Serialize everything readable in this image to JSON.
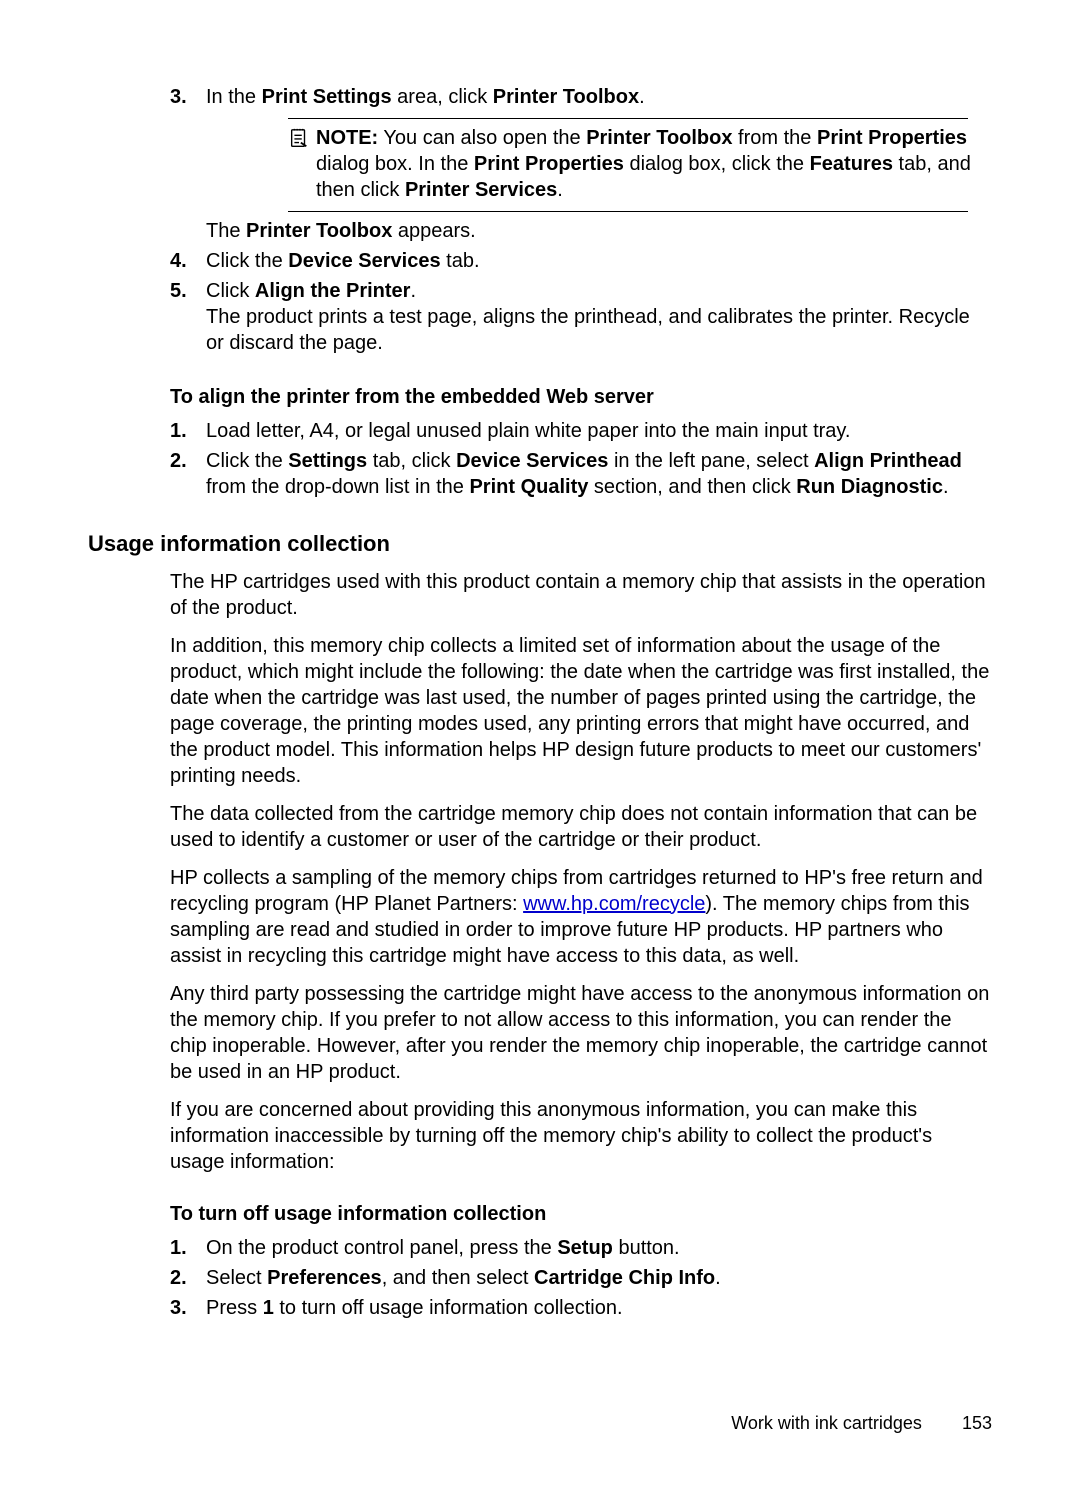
{
  "list1": {
    "items": [
      {
        "num": "3.",
        "parts": [
          {
            "t": "In the "
          },
          {
            "t": "Print Settings",
            "b": true
          },
          {
            "t": " area, click "
          },
          {
            "t": "Printer Toolbox",
            "b": true
          },
          {
            "t": "."
          }
        ],
        "note": {
          "label": "NOTE:",
          "parts": [
            {
              "t": "You can also open the "
            },
            {
              "t": "Printer Toolbox",
              "b": true
            },
            {
              "t": " from the "
            },
            {
              "t": "Print Properties",
              "b": true
            },
            {
              "t": " dialog box. In the "
            },
            {
              "t": "Print Properties",
              "b": true
            },
            {
              "t": " dialog box, click the "
            },
            {
              "t": "Features",
              "b": true
            },
            {
              "t": " tab, and then click "
            },
            {
              "t": "Printer Services",
              "b": true
            },
            {
              "t": "."
            }
          ]
        },
        "after": [
          {
            "t": "The "
          },
          {
            "t": "Printer Toolbox",
            "b": true
          },
          {
            "t": " appears."
          }
        ]
      },
      {
        "num": "4.",
        "parts": [
          {
            "t": "Click the "
          },
          {
            "t": "Device Services",
            "b": true
          },
          {
            "t": " tab."
          }
        ]
      },
      {
        "num": "5.",
        "parts": [
          {
            "t": "Click "
          },
          {
            "t": "Align the Printer",
            "b": true
          },
          {
            "t": "."
          }
        ],
        "sub": [
          {
            "t": "The product prints a test page, aligns the printhead, and calibrates the printer. Recycle or discard the page."
          }
        ]
      }
    ]
  },
  "align_ews_heading": "To align the printer from the embedded Web server",
  "list2": {
    "items": [
      {
        "num": "1.",
        "parts": [
          {
            "t": "Load letter, A4, or legal unused plain white paper into the main input tray."
          }
        ]
      },
      {
        "num": "2.",
        "parts": [
          {
            "t": "Click the "
          },
          {
            "t": "Settings",
            "b": true
          },
          {
            "t": " tab, click "
          },
          {
            "t": "Device Services",
            "b": true
          },
          {
            "t": " in the left pane, select "
          },
          {
            "t": "Align Printhead",
            "b": true
          },
          {
            "t": " from the drop-down list in the "
          },
          {
            "t": "Print Quality",
            "b": true
          },
          {
            "t": " section, and then click "
          },
          {
            "t": "Run Diagnostic",
            "b": true
          },
          {
            "t": "."
          }
        ]
      }
    ]
  },
  "usage_heading": "Usage information collection",
  "usage_paras": [
    [
      {
        "t": "The HP cartridges used with this product contain a memory chip that assists in the operation of the product."
      }
    ],
    [
      {
        "t": "In addition, this memory chip collects a limited set of information about the usage of the product, which might include the following: the date when the cartridge was first installed, the date when the cartridge was last used, the number of pages printed using the cartridge, the page coverage, the printing modes used, any printing errors that might have occurred, and the product model. This information helps HP design future products to meet our customers' printing needs."
      }
    ],
    [
      {
        "t": "The data collected from the cartridge memory chip does not contain information that can be used to identify a customer or user of the cartridge or their product."
      }
    ],
    [
      {
        "t": "HP collects a sampling of the memory chips from cartridges returned to HP's free return and recycling program (HP Planet Partners: "
      },
      {
        "t": "www.hp.com/recycle",
        "link": true
      },
      {
        "t": "). The memory chips from this sampling are read and studied in order to improve future HP products. HP partners who assist in recycling this cartridge might have access to this data, as well."
      }
    ],
    [
      {
        "t": "Any third party possessing the cartridge might have access to the anonymous information on the memory chip. If you prefer to not allow access to this information, you can render the chip inoperable. However, after you render the memory chip inoperable, the cartridge cannot be used in an HP product."
      }
    ],
    [
      {
        "t": "If you are concerned about providing this anonymous information, you can make this information inaccessible by turning off the memory chip's ability to collect the product's usage information:"
      }
    ]
  ],
  "turnoff_heading": "To turn off usage information collection",
  "list3": {
    "items": [
      {
        "num": "1.",
        "parts": [
          {
            "t": "On the product control panel, press the "
          },
          {
            "t": "Setup",
            "b": true
          },
          {
            "t": " button."
          }
        ]
      },
      {
        "num": "2.",
        "parts": [
          {
            "t": "Select "
          },
          {
            "t": "Preferences",
            "b": true
          },
          {
            "t": ", and then select "
          },
          {
            "t": "Cartridge Chip Info",
            "b": true
          },
          {
            "t": "."
          }
        ]
      },
      {
        "num": "3.",
        "parts": [
          {
            "t": "Press "
          },
          {
            "t": "1",
            "b": true
          },
          {
            "t": " to turn off usage information collection."
          }
        ]
      }
    ]
  },
  "footer": {
    "section": "Work with ink cartridges",
    "page": "153"
  }
}
